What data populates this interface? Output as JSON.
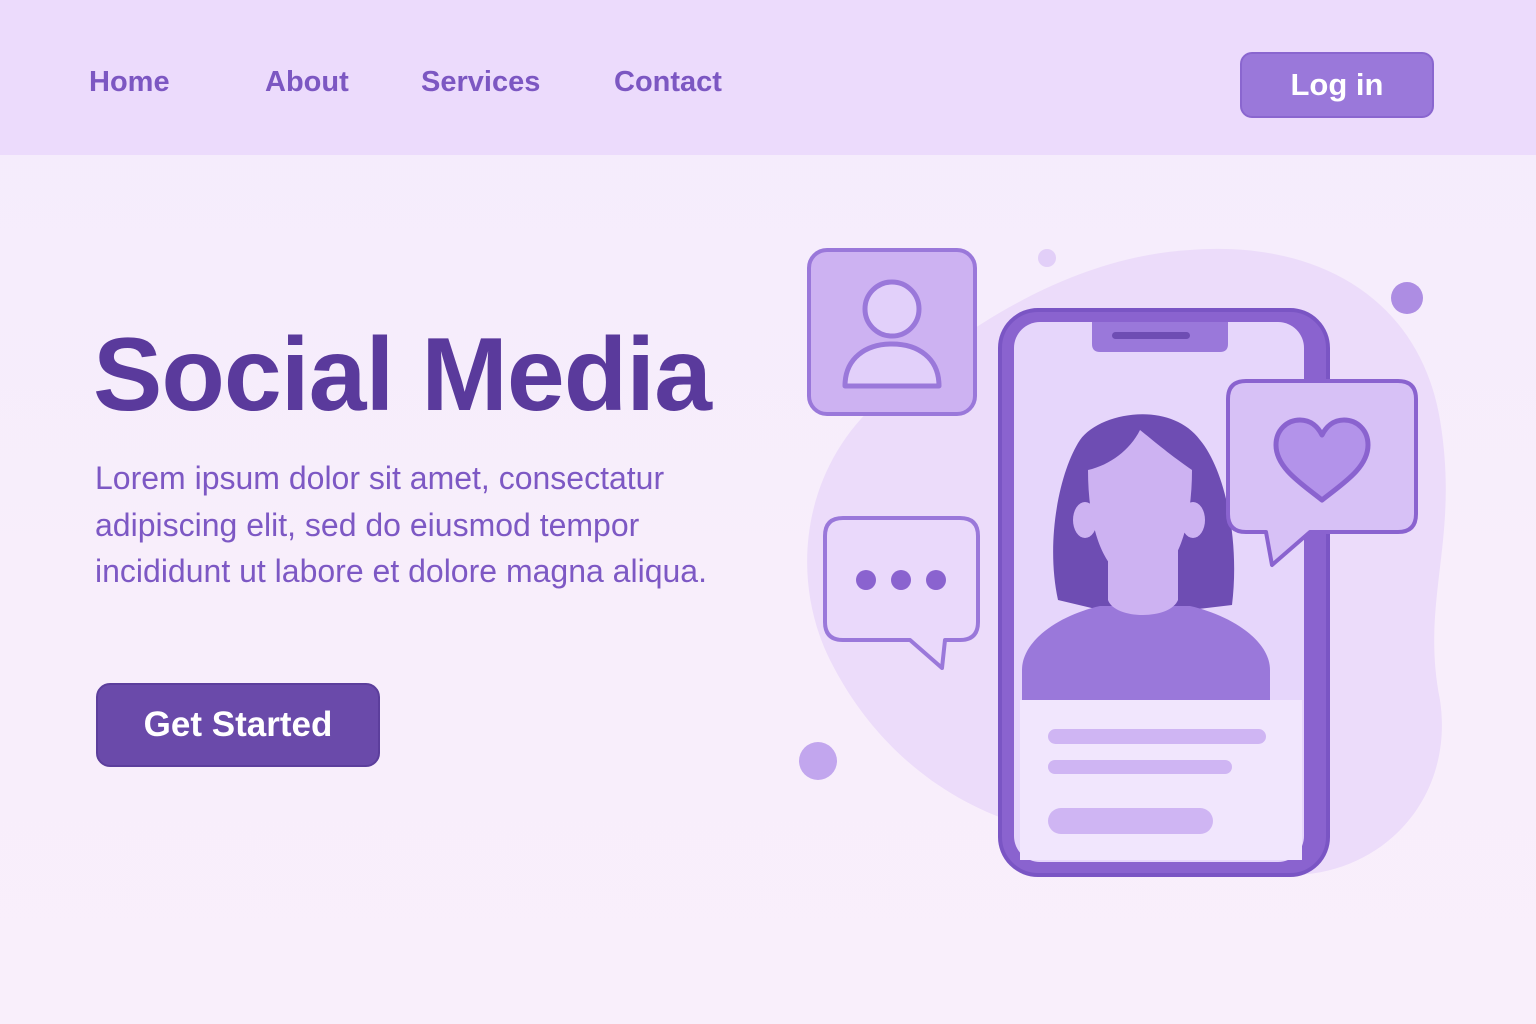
{
  "nav": {
    "links": [
      "Home",
      "About",
      "Services",
      "Contact"
    ],
    "login_label": "Log in"
  },
  "hero": {
    "title": "Social Media",
    "description": "Lorem ipsum dolor sit amet, consectatur adipiscing elit, sed do eiusmod tempor incididunt ut labore et dolore magna aliqua.",
    "cta_label": "Get Started"
  },
  "illustration": {
    "icons": [
      "user-profile-icon",
      "chat-bubble-icon",
      "heart-icon",
      "smartphone-icon",
      "woman-avatar-icon"
    ]
  },
  "colors": {
    "nav_bg": "#ecdbfc",
    "page_bg": "#f6eefc",
    "title": "#5a3a9c",
    "text": "#7d58c4",
    "primary_button": "#6a4aaa",
    "login_button": "#9a78da",
    "accent_light": "#d3bdf5"
  }
}
